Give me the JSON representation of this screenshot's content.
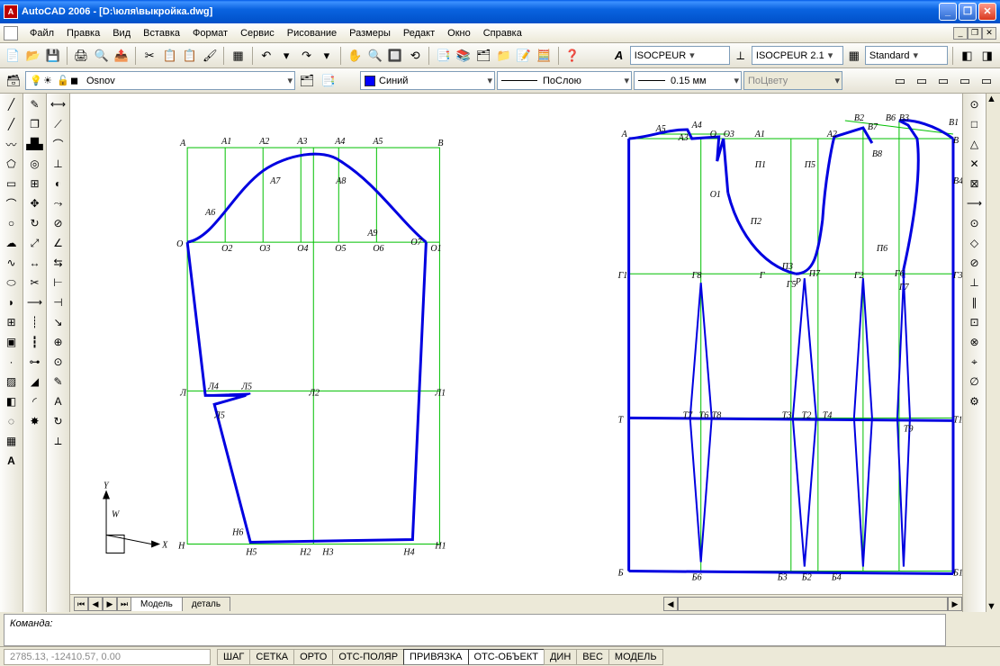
{
  "title": "AutoCAD 2006 - [D:\\юля\\выкройка.dwg]",
  "menu": [
    "Файл",
    "Правка",
    "Вид",
    "Вставка",
    "Формат",
    "Сервис",
    "Рисование",
    "Размеры",
    "Редакт",
    "Окно",
    "Справка"
  ],
  "text_style_dropdowns": {
    "font": "ISOCPEUR",
    "dim": "ISOCPEUR 2.1",
    "tablestyle": "Standard"
  },
  "layer_row": {
    "current": "Osnov",
    "color_name": "Синий",
    "linetype": "ПоСлою",
    "lineweight": "0.15 мм",
    "bycolor": "ПоЦвету"
  },
  "tabs": {
    "model": "Модель",
    "sheet": "деталь"
  },
  "cmd_prompt": "Команда:",
  "coords": "2785.13, -12410.57, 0.00",
  "status_modes": [
    "ШАГ",
    "СЕТКА",
    "ОРТО",
    "ОТС-ПОЛЯР",
    "ПРИВЯЗКА",
    "ОТС-ОБЪЕКТ",
    "ДИН",
    "ВЕС",
    "МОДЕЛЬ"
  ],
  "active_modes": [
    4,
    5
  ],
  "drawing_labels_left": {
    "A": "А",
    "A1": "А1",
    "A2": "А2",
    "A3": "А3",
    "A4": "А4",
    "A5": "А5",
    "B": "В",
    "A6": "А6",
    "A7": "А7",
    "A8": "А8",
    "A9": "А9",
    "O": "О",
    "O2": "О2",
    "O3": "О3",
    "O4": "О4",
    "O5": "О5",
    "O6": "О6",
    "O7": "О7",
    "O1": "О1",
    "L": "Л",
    "L4": "Л4",
    "L5": "Л5",
    "L2": "Л2",
    "L1": "Л1",
    "L5b": "Л5",
    "N": "Н",
    "N6": "Н6",
    "N5": "Н5",
    "N2": "Н2",
    "N3": "Н3",
    "N4": "Н4",
    "N1": "Н1"
  },
  "drawing_labels_right": {
    "A": "А",
    "A5": "А5",
    "A3": "А3",
    "A4": "А4",
    "O": "О",
    "O3": "О3",
    "A1": "А1",
    "A2": "А2",
    "B2": "В2",
    "B7": "В7",
    "B6": "В6",
    "B3": "В3",
    "B1": "В1",
    "B": "В",
    "B8": "В8",
    "B4": "В4",
    "O1": "О1",
    "P1": "П1",
    "P5": "П5",
    "P2": "П2",
    "P3": "П3",
    "P7": "П7",
    "P": "Р",
    "G2": "Г2",
    "P6": "П6",
    "G1": "Г1",
    "G8": "Г8",
    "G": "Г",
    "G5": "Г5",
    "G6": "Г6",
    "G7": "Г7",
    "G3": "Г3",
    "T": "Т",
    "T7": "Т7",
    "T6": "Т6",
    "T8": "Т8",
    "T3": "Т3",
    "T2": "Т2",
    "T4": "Т4",
    "T9": "Т9",
    "T1": "Т1",
    "B_bot": "Б",
    "B6b": "Б6",
    "B3b": "Б3",
    "B2b": "Б2",
    "B4b": "Б4",
    "B1b": "Б1"
  },
  "ucs": {
    "y": "Y",
    "w": "W",
    "x": "X"
  }
}
